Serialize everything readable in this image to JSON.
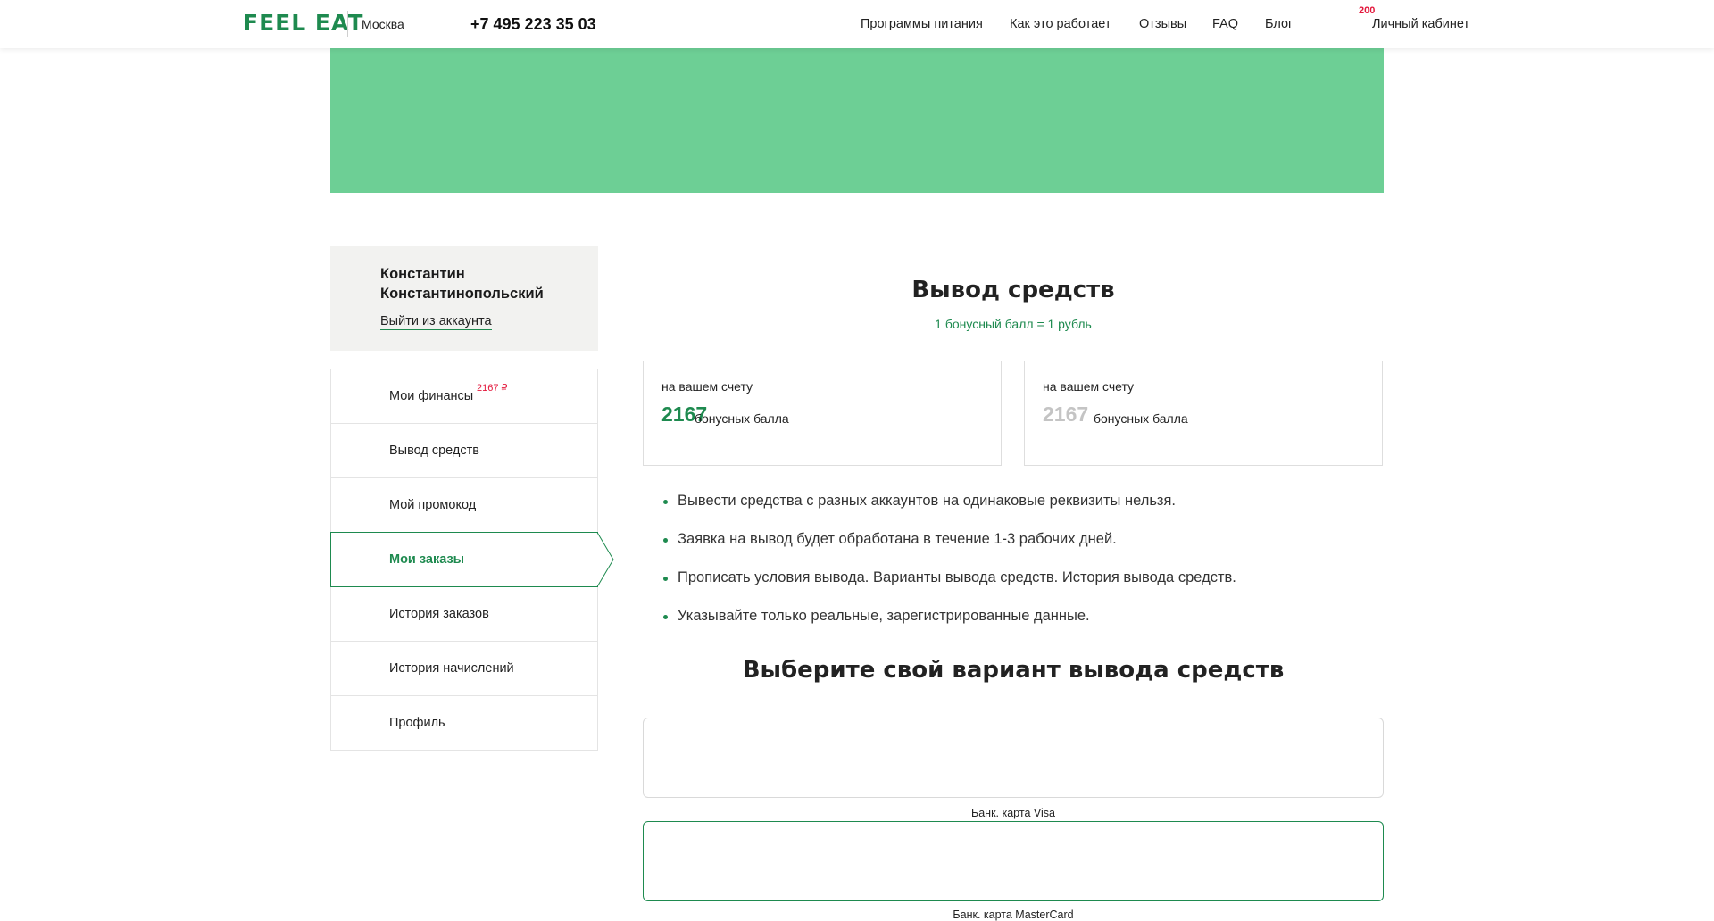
{
  "header": {
    "logo": "FEEL EAT",
    "city": "Москва",
    "phone": "+7 495 223 35 03",
    "nav": [
      "Программы питания",
      "Как это работает",
      "Отзывы",
      "FAQ",
      "Блог"
    ],
    "cabinet_label": "Личный кабинет",
    "cabinet_badge": "200"
  },
  "profile": {
    "name": "Константин Константинопольский",
    "logout": "Выйти из аккаунта"
  },
  "side_menu": {
    "items": [
      {
        "label": "Мои финансы",
        "badge": "2167 ₽"
      },
      {
        "label": "Вывод средств"
      },
      {
        "label": "Мой промокод"
      },
      {
        "label": "Мои заказы",
        "active": true
      },
      {
        "label": "История заказов"
      },
      {
        "label": "История начислений"
      },
      {
        "label": "Профиль"
      }
    ]
  },
  "main": {
    "title": "Вывод средств",
    "rate": "1 бонусный балл = 1 рубль",
    "balances": [
      {
        "label": "на вашем счету",
        "amount": "2167",
        "unit": "бонусных балла",
        "color": "#1e8a4f"
      },
      {
        "label": "на вашем счету",
        "amount": "2167",
        "unit": "бонусных балла",
        "color": "#c4c4c4"
      }
    ],
    "rules": [
      "Вывести средства с разных аккаунтов на одинаковые реквизиты нельзя.",
      "Заявка на вывод будет обработана в течение 1-3 рабочих дней.",
      "Прописать условия вывода. Варианты вывода средств. История вывода средств.",
      "Указывайте только реальные, зарегистрированные данные."
    ],
    "subtitle": "Выберите свой вариант вывода средств",
    "options": [
      {
        "label": "Банк. карта Visa",
        "selected": false
      },
      {
        "label": "Банк. карта MasterCard",
        "selected": true
      }
    ]
  },
  "colors": {
    "accent": "#1e8a4f",
    "banner": "#6dcf95",
    "badge": "#e3183c"
  }
}
